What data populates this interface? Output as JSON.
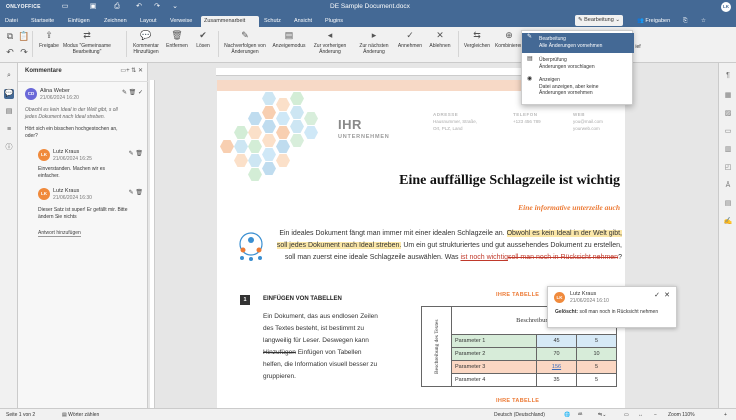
{
  "app": {
    "brand": "ONLYOFFICE",
    "doc_title": "DE Sample Document.docx",
    "user_initials": "LK"
  },
  "tabs": [
    "Datei",
    "Startseite",
    "Einfügen",
    "Zeichnen",
    "Layout",
    "Verweise",
    "Zusammenarbeit",
    "Schutz",
    "Ansicht",
    "Plugins"
  ],
  "active_tab": "Zusammenarbeit",
  "header_right": {
    "mode": "Bearbeitung",
    "share": "Freigaben"
  },
  "toolbar": {
    "share": "Freigabe",
    "coedit_mode": "Modus \"Gemeinsame Bearbeitung\"",
    "add_comment": "Kommentar Hinzufügen",
    "remove": "Entfernen",
    "resolve": "Lösen",
    "track_changes": "Nachverfolgen von Änderungen",
    "display_mode": "Anzeigemodus",
    "prev_change": "Zur vorherigen Änderung",
    "next_change": "Zur nächsten Änderung",
    "accept": "Annehmen",
    "reject": "Ablehnen",
    "compare": "Vergleichen",
    "combine": "Kombinieren",
    "cut_label": "ief"
  },
  "mode_dropdown": [
    {
      "title": "Bearbeitung",
      "desc": "Alle Änderungen vornehmen",
      "selected": true
    },
    {
      "title": "Überprüfung",
      "desc": "Änderungen vorschlagen",
      "selected": false
    },
    {
      "title": "Anzeigen",
      "desc": "Datei anzeigen, aber keine Änderungen vornehmen",
      "selected": false
    }
  ],
  "comments_panel": {
    "title": "Kommentare",
    "comments": [
      {
        "initials": "CD",
        "name": "Alina Weber",
        "date": "21/06/2024 16:20",
        "quote": "Obwohl es kein Ideal in der Welt gibt, s oll jedes Dokument nach Ideal streben.",
        "text": "Hört sich ein bisschen hochgestochen an, oder?",
        "color": "#6a68d8"
      },
      {
        "initials": "LK",
        "name": "Lutz Kraus",
        "date": "21/06/2024 16:25",
        "text": "Einverstanden. Machen wir es einfacher.",
        "color": "#f08a3c"
      },
      {
        "initials": "LK",
        "name": "Lutz Kraus",
        "date": "21/06/2024 16:30",
        "text": "Dieser Satz ist super! Er gefällt mir. Bitte ändern Sie nichts",
        "color": "#f08a3c"
      }
    ],
    "add_reply": "Antwort hinzufügen"
  },
  "document": {
    "logo_main": "IHR",
    "logo_sub": "UNTERNEHMEN",
    "header_cols": [
      {
        "label": "ADRESSE",
        "lines": [
          "Hausnummer, Straße,",
          "Ort, PLZ, Land"
        ]
      },
      {
        "label": "TELEFON",
        "lines": [
          "+123 456 789"
        ]
      },
      {
        "label": "WEB",
        "lines": [
          "you@mail.com",
          "yourweb.com"
        ]
      }
    ],
    "headline": "Eine auffällige Schlagzeile ist wichtig",
    "subheadline": "Eine informative unterzeile auch",
    "para_a": "Ein ideales Dokument fängt man immer mit einer idealen Schlagzeile an.",
    "para_highlight": "Obwohl es kein Ideal in der Welt gibt, soll jedes Dokument nach Ideal streben.",
    "para_b": " Um ein gut strukturiertes und gut aussehendes Dokument zu erstellen, soll man zuerst eine ideale Schlagzeile auswählen. Was ",
    "para_ins": "ist noch wichtig",
    "para_del": "soll man noch in Rücksicht nehmen",
    "para_end": "?",
    "section_number": "1",
    "section_title": "EINFÜGEN VON TABELLEN",
    "section_body_a": "Ein Dokument, das aus endlosen Zeilen des Textes besteht, ist bestimmt zu langweilig für Leser. Deswegen kann ",
    "section_body_del": "Hinzufügen",
    "section_body_b": " Einfügen von Tabellen helfen, die Information visuell besser zu gruppieren.",
    "table_title": "IHRE TABELLE",
    "table_header": "Beschreibung",
    "table_side": "Beschreibung des Textes",
    "table_rows": [
      {
        "name": "Parameter 1",
        "v1": "45",
        "v2": "5"
      },
      {
        "name": "Parameter 2",
        "v1": "70",
        "v2": "10"
      },
      {
        "name": "Parameter 3",
        "v1": "156",
        "v2": "5"
      },
      {
        "name": "Parameter 4",
        "v1": "35",
        "v2": "5"
      }
    ],
    "table_title_2": "IHRE TABELLE"
  },
  "balloon": {
    "initials": "LK",
    "name": "Lutz Kraus",
    "date": "21/06/2024 16:10",
    "label": "Gelöscht:",
    "text": "soll man noch in Rücksicht nehmen"
  },
  "status": {
    "page": "Seite 1 von 2",
    "word_count": "Wörter zählen",
    "language": "Deutsch (Deutschland)",
    "zoom": "Zoom 110%"
  }
}
